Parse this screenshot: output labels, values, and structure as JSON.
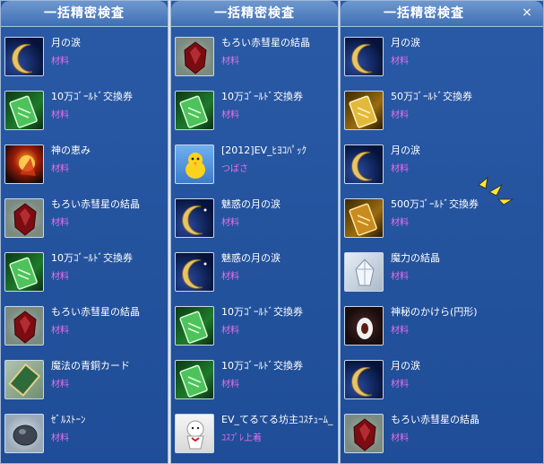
{
  "panels": [
    {
      "title": "一括精密検査",
      "items": [
        {
          "name": "月の涙",
          "sub": "材料",
          "icon": "moon-icon"
        },
        {
          "name": "10万ｺﾞｰﾙﾄﾞ交換券",
          "sub": "材料",
          "icon": "ticket-icon"
        },
        {
          "name": "神の恵み",
          "sub": "材料",
          "icon": "fire-orb-icon"
        },
        {
          "name": "もろい赤彗星の結晶",
          "sub": "材料",
          "icon": "red-crystal-icon"
        },
        {
          "name": "10万ｺﾞｰﾙﾄﾞ交換券",
          "sub": "材料",
          "icon": "ticket-icon"
        },
        {
          "name": "もろい赤彗星の結晶",
          "sub": "材料",
          "icon": "red-crystal-icon"
        },
        {
          "name": "魔法の青銅カード",
          "sub": "材料",
          "icon": "card-icon"
        },
        {
          "name": "ｾﾞﾙｽﾄｰﾝ",
          "sub": "材料",
          "icon": "stone-icon"
        }
      ]
    },
    {
      "title": "一括精密検査",
      "items": [
        {
          "name": "もろい赤彗星の結晶",
          "sub": "材料",
          "icon": "red-crystal-icon"
        },
        {
          "name": "10万ｺﾞｰﾙﾄﾞ交換券",
          "sub": "材料",
          "icon": "ticket-icon"
        },
        {
          "name": "[2012]EV_ﾋﾖｺﾊﾟｯｸ",
          "sub": "つばさ",
          "icon": "chick-icon"
        },
        {
          "name": "魅惑の月の涙",
          "sub": "材料",
          "icon": "moon-icon"
        },
        {
          "name": "魅惑の月の涙",
          "sub": "材料",
          "icon": "moon-icon"
        },
        {
          "name": "10万ｺﾞｰﾙﾄﾞ交換券",
          "sub": "材料",
          "icon": "ticket-icon"
        },
        {
          "name": "10万ｺﾞｰﾙﾄﾞ交換券",
          "sub": "材料",
          "icon": "ticket-icon"
        },
        {
          "name": "EV_てるてる坊主ｺｽﾁｭｰﾑ_",
          "sub": "ｺｽﾌﾟﾚ上着",
          "icon": "doll-icon"
        }
      ]
    },
    {
      "title": "一括精密検査",
      "items": [
        {
          "name": "月の涙",
          "sub": "材料",
          "icon": "moon-icon"
        },
        {
          "name": "50万ｺﾞｰﾙﾄﾞ交換券",
          "sub": "材料",
          "icon": "gold-ticket-icon"
        },
        {
          "name": "月の涙",
          "sub": "材料",
          "icon": "moon-icon"
        },
        {
          "name": "500万ｺﾞｰﾙﾄﾞ交換券",
          "sub": "材料",
          "icon": "gold-ticket-icon"
        },
        {
          "name": "魔力の結晶",
          "sub": "材料",
          "icon": "crystal-icon"
        },
        {
          "name": "神秘のかけら(円形)",
          "sub": "材料",
          "icon": "dark-shard-icon"
        },
        {
          "name": "月の涙",
          "sub": "材料",
          "icon": "moon-icon"
        },
        {
          "name": "もろい赤彗星の結晶",
          "sub": "材料",
          "icon": "red-crystal-icon"
        }
      ]
    }
  ],
  "close_label": "×",
  "colors": {
    "panel_bg": "#1f4d97",
    "title_text": "#ffffff",
    "item_name": "#ffffff",
    "item_sub": "#e66fe6"
  }
}
